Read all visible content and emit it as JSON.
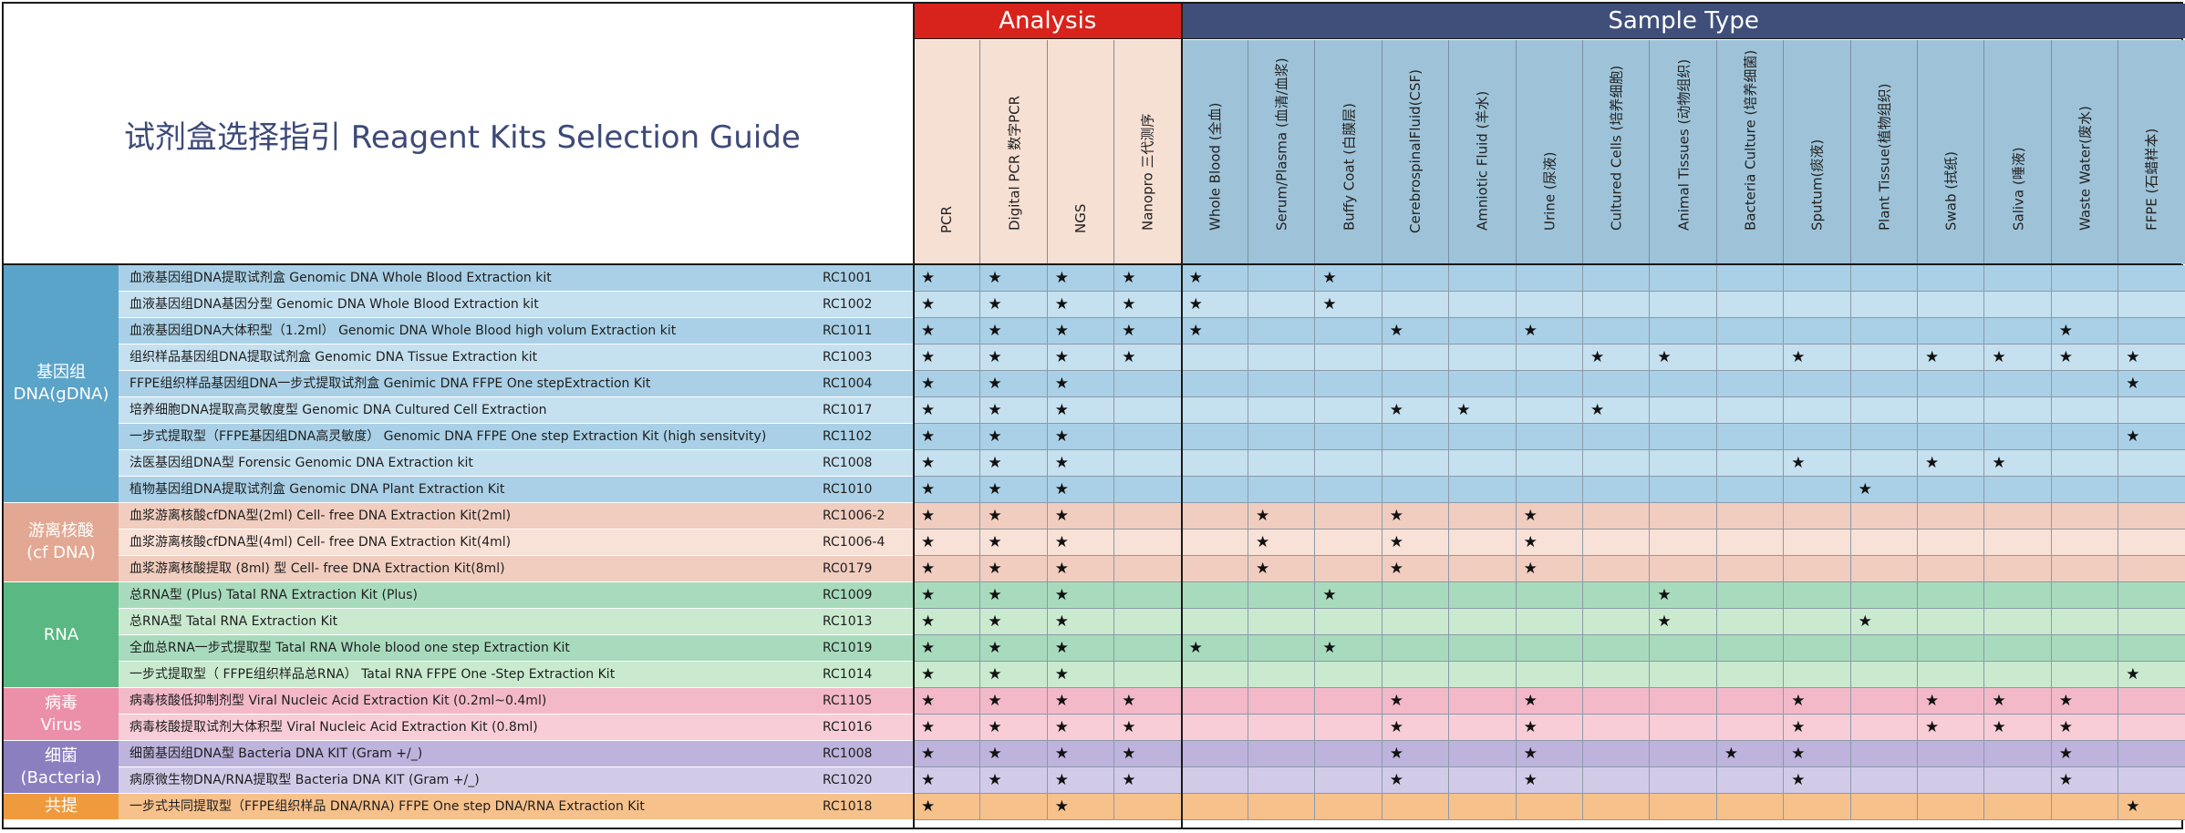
{
  "title": "试剂盒选择指引  Reagent Kits Selection Guide",
  "bands": {
    "analysis": "Analysis",
    "sample_type": "Sample Type"
  },
  "colors": {
    "analysis_band": "#d8231c",
    "sample_band": "#3f4f7a",
    "analysis_header_bg": "#f6dfd3",
    "sample_header_bg": "#9ec3d8",
    "title_text": "#3d4a78"
  },
  "columns": [
    {
      "label": "PCR",
      "kind": "analysis"
    },
    {
      "label": "Digital PCR 数字PCR",
      "kind": "analysis"
    },
    {
      "label": "NGS",
      "kind": "analysis"
    },
    {
      "label": "Nanopro 三代测序",
      "kind": "analysis"
    },
    {
      "label": "Whole Blood (全血)",
      "kind": "sample"
    },
    {
      "label": "Serum/Plasma (血清/血浆)",
      "kind": "sample"
    },
    {
      "label": "Buffy Coat (白膜层)",
      "kind": "sample"
    },
    {
      "label": "CerebrospinalFluid(CSF)",
      "kind": "sample"
    },
    {
      "label": "Amniotic Fluid (羊水)",
      "kind": "sample"
    },
    {
      "label": "Urine (尿液)",
      "kind": "sample"
    },
    {
      "label": "Cultured Cells (培养细胞)",
      "kind": "sample"
    },
    {
      "label": "Animal Tissues (动物组织)",
      "kind": "sample"
    },
    {
      "label": "Bacteria Culture (培养细菌)",
      "kind": "sample"
    },
    {
      "label": "Sputum(痰液)",
      "kind": "sample"
    },
    {
      "label": "Plant Tissue(植物组织)",
      "kind": "sample"
    },
    {
      "label": "Swab (拭纸)",
      "kind": "sample"
    },
    {
      "label": "Saliva (唾液)",
      "kind": "sample"
    },
    {
      "label": "Waste Water(废水)",
      "kind": "sample"
    },
    {
      "label": "FFPE (石蜡样本)",
      "kind": "sample"
    }
  ],
  "star": "★",
  "groups": [
    {
      "label": "基因组\nDNA(gDNA)",
      "color": "#5aa3c9",
      "rows": [
        {
          "kit": "血液基因组DNA提取试剂盒      Genomic DNA  Whole Blood Extraction kit",
          "cat": "RC1001",
          "bg": "#a9d0e6",
          "marks": [
            1,
            1,
            1,
            1,
            1,
            0,
            1,
            0,
            0,
            0,
            0,
            0,
            0,
            0,
            0,
            0,
            0,
            0,
            0
          ]
        },
        {
          "kit": "血液基因组DNA基因分型      Genomic DNA  Whole Blood Extraction kit",
          "cat": "RC1002",
          "bg": "#c5e0ef",
          "marks": [
            1,
            1,
            1,
            1,
            1,
            0,
            1,
            0,
            0,
            0,
            0,
            0,
            0,
            0,
            0,
            0,
            0,
            0,
            0
          ]
        },
        {
          "kit": "血液基因组DNA大体积型（1.2ml）   Genomic DNA  Whole Blood  high volum Extraction kit",
          "cat": "RC1011",
          "bg": "#a9d0e6",
          "marks": [
            1,
            1,
            1,
            1,
            1,
            0,
            0,
            1,
            0,
            1,
            0,
            0,
            0,
            0,
            0,
            0,
            0,
            1,
            0
          ]
        },
        {
          "kit": "组织样品基因组DNA提取试剂盒  Genomic DNA Tissue Extraction kit",
          "cat": "RC1003",
          "bg": "#c5e0ef",
          "marks": [
            1,
            1,
            1,
            1,
            0,
            0,
            0,
            0,
            0,
            0,
            1,
            1,
            0,
            1,
            0,
            1,
            1,
            1,
            1
          ]
        },
        {
          "kit": "FFPE组织样品基因组DNA一步式提取试剂盒   Genimic DNA  FFPE One stepExtraction Kit",
          "cat": "RC1004",
          "bg": "#a9d0e6",
          "marks": [
            1,
            1,
            1,
            0,
            0,
            0,
            0,
            0,
            0,
            0,
            0,
            0,
            0,
            0,
            0,
            0,
            0,
            0,
            1
          ]
        },
        {
          "kit": "培养细胞DNA提取高灵敏度型   Genomic DNA Cultured Cell Extraction",
          "cat": "RC1017",
          "bg": "#c5e0ef",
          "marks": [
            1,
            1,
            1,
            0,
            0,
            0,
            0,
            1,
            1,
            0,
            1,
            0,
            0,
            0,
            0,
            0,
            0,
            0,
            0
          ]
        },
        {
          "kit": "一步式提取型（FFPE基因组DNA高灵敏度）     Genomic DNA  FFPE One step  Extraction Kit (high sensitvity)",
          "cat": "RC1102",
          "bg": "#a9d0e6",
          "marks": [
            1,
            1,
            1,
            0,
            0,
            0,
            0,
            0,
            0,
            0,
            0,
            0,
            0,
            0,
            0,
            0,
            0,
            0,
            1
          ]
        },
        {
          "kit": "法医基因组DNA型          Forensic Genomic DNA Extraction kit",
          "cat": "RC1008",
          "bg": "#c5e0ef",
          "marks": [
            1,
            1,
            1,
            0,
            0,
            0,
            0,
            0,
            0,
            0,
            0,
            0,
            0,
            1,
            0,
            1,
            1,
            0,
            0
          ]
        },
        {
          "kit": "植物基因组DNA提取试剂盒        Genomic DNA Plant Extraction Kit",
          "cat": "RC1010",
          "bg": "#a9d0e6",
          "marks": [
            1,
            1,
            1,
            0,
            0,
            0,
            0,
            0,
            0,
            0,
            0,
            0,
            0,
            0,
            1,
            0,
            0,
            0,
            0
          ]
        }
      ]
    },
    {
      "label": "游离核酸\n(cf DNA)",
      "color": "#e2a893",
      "rows": [
        {
          "kit": "血浆游离核酸cfDNA型(2ml)        Cell- free DNA Extraction Kit(2ml)",
          "cat": "RC1006-2",
          "bg": "#f0cdbf",
          "marks": [
            1,
            1,
            1,
            0,
            0,
            1,
            0,
            1,
            0,
            1,
            0,
            0,
            0,
            0,
            0,
            0,
            0,
            0,
            0
          ]
        },
        {
          "kit": "血浆游离核酸cfDNA型(4ml)          Cell- free DNA Extraction Kit(4ml)",
          "cat": "RC1006-4",
          "bg": "#f8e1d7",
          "marks": [
            1,
            1,
            1,
            0,
            0,
            1,
            0,
            1,
            0,
            1,
            0,
            0,
            0,
            0,
            0,
            0,
            0,
            0,
            0
          ]
        },
        {
          "kit": "血浆游离核酸提取 (8ml) 型    Cell- free DNA Extraction Kit(8ml)",
          "cat": "RC0179",
          "bg": "#f0cdbf",
          "marks": [
            1,
            1,
            1,
            0,
            0,
            1,
            0,
            1,
            0,
            1,
            0,
            0,
            0,
            0,
            0,
            0,
            0,
            0,
            0
          ]
        }
      ]
    },
    {
      "label": "RNA",
      "color": "#5ab882",
      "rows": [
        {
          "kit": "总RNA型 (Plus)  Tatal RNA Extraction Kit (Plus)",
          "cat": "RC1009",
          "bg": "#a8dbbd",
          "marks": [
            1,
            1,
            1,
            0,
            0,
            0,
            1,
            0,
            0,
            0,
            0,
            1,
            0,
            0,
            0,
            0,
            0,
            0,
            0
          ]
        },
        {
          "kit": "总RNA型    Tatal RNA Extraction Kit",
          "cat": "RC1013",
          "bg": "#c9eacf",
          "marks": [
            1,
            1,
            1,
            0,
            0,
            0,
            0,
            0,
            0,
            0,
            0,
            1,
            0,
            0,
            1,
            0,
            0,
            0,
            0
          ]
        },
        {
          "kit": "全血总RNA一步式提取型  Tatal RNA Whole blood  one step Extraction Kit",
          "cat": "RC1019",
          "bg": "#a8dbbd",
          "marks": [
            1,
            1,
            1,
            0,
            1,
            0,
            1,
            0,
            0,
            0,
            0,
            0,
            0,
            0,
            0,
            0,
            0,
            0,
            0
          ]
        },
        {
          "kit": "一步式提取型（ FFPE组织样品总RNA）  Tatal RNA FFPE One -Step Extraction Kit",
          "cat": "RC1014",
          "bg": "#c9eacf",
          "marks": [
            1,
            1,
            1,
            0,
            0,
            0,
            0,
            0,
            0,
            0,
            0,
            0,
            0,
            0,
            0,
            0,
            0,
            0,
            1
          ]
        }
      ]
    },
    {
      "label": "病毒\nVirus",
      "color": "#ec8fa8",
      "rows": [
        {
          "kit": "病毒核酸低抑制剂型      Viral Nucleic Acid Extraction Kit (0.2ml~0.4ml)",
          "cat": "RC1105",
          "bg": "#f3b9c9",
          "marks": [
            1,
            1,
            1,
            1,
            0,
            0,
            0,
            1,
            0,
            1,
            0,
            0,
            0,
            1,
            0,
            1,
            1,
            1,
            0
          ]
        },
        {
          "kit": "病毒核酸提取试剂大体积型  Viral Nucleic Acid Extraction Kit (0.8ml)",
          "cat": "RC1016",
          "bg": "#f8cdd8",
          "marks": [
            1,
            1,
            1,
            1,
            0,
            0,
            0,
            1,
            0,
            1,
            0,
            0,
            0,
            1,
            0,
            1,
            1,
            1,
            0
          ]
        }
      ]
    },
    {
      "label": "细菌\n(Bacteria)",
      "color": "#8b7fc0",
      "rows": [
        {
          "kit": "细菌基因组DNA型  Bacteria DNA KIT (Gram +/_)",
          "cat": "RC1008",
          "bg": "#bdb3dd",
          "marks": [
            1,
            1,
            1,
            1,
            0,
            0,
            0,
            1,
            0,
            1,
            0,
            0,
            1,
            1,
            0,
            0,
            0,
            1,
            0
          ]
        },
        {
          "kit": "病原微生物DNA/RNA提取型   Bacteria DNA KIT (Gram +/_)",
          "cat": "RC1020",
          "bg": "#d2cbe8",
          "marks": [
            1,
            1,
            1,
            1,
            0,
            0,
            0,
            1,
            0,
            1,
            0,
            0,
            0,
            1,
            0,
            0,
            0,
            1,
            0
          ]
        }
      ]
    },
    {
      "label": "共提",
      "color": "#f09a3e",
      "rows": [
        {
          "kit": "一步式共同提取型（FFPE组织样品 DNA/RNA)     FFPE One step DNA/RNA Extraction Kit",
          "cat": "RC1018",
          "bg": "#f7c18b",
          "marks": [
            1,
            0,
            1,
            0,
            0,
            0,
            0,
            0,
            0,
            0,
            0,
            0,
            0,
            0,
            0,
            0,
            0,
            0,
            1
          ]
        }
      ]
    }
  ]
}
